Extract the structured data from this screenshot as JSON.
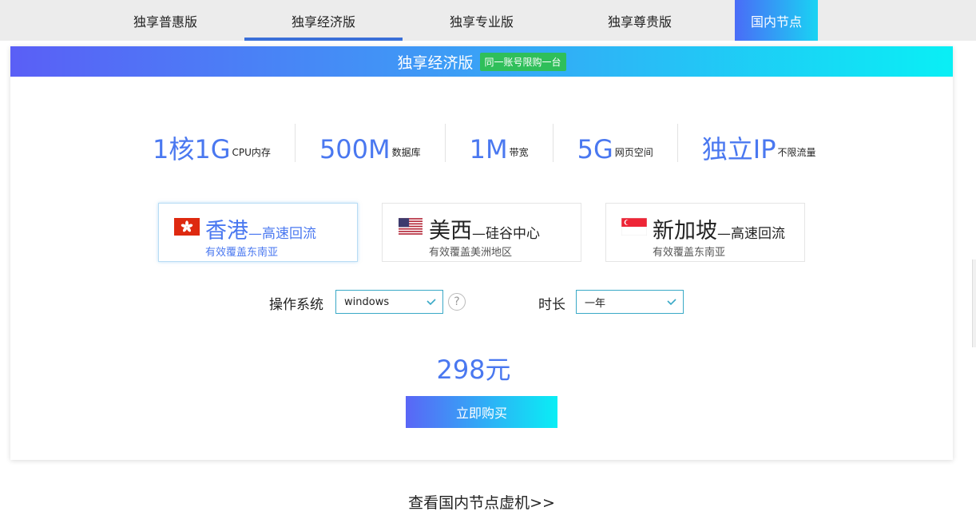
{
  "tabs": [
    {
      "label": "独享普惠版"
    },
    {
      "label": "独享经济版"
    },
    {
      "label": "独享专业版"
    },
    {
      "label": "独享尊贵版"
    },
    {
      "label": "国内节点"
    }
  ],
  "active_tab": "独享经济版",
  "card": {
    "title": "独享经济版",
    "limit_badge": "同一账号限购一台"
  },
  "specs": [
    {
      "value": "1核1G",
      "unit": "CPU内存"
    },
    {
      "value": "500M",
      "unit": "数据库"
    },
    {
      "value": "1M",
      "unit": "带宽"
    },
    {
      "value": "5G",
      "unit": "网页空间"
    },
    {
      "value": "独立IP",
      "unit": "不限流量"
    }
  ],
  "regions": [
    {
      "name": "香港",
      "sub": "—高速回流",
      "desc": "有效覆盖东南亚",
      "flag": "hong-kong-flag-icon",
      "selected": true
    },
    {
      "name": "美西",
      "sub": "—硅谷中心",
      "desc": "有效覆盖美洲地区",
      "flag": "usa-flag-icon",
      "selected": false
    },
    {
      "name": "新加坡",
      "sub": "—高速回流",
      "desc": "有效覆盖东南亚",
      "flag": "singapore-flag-icon",
      "selected": false
    }
  ],
  "options": {
    "os_label": "操作系统",
    "os_value": "windows",
    "help_symbol": "?",
    "duration_label": "时长",
    "duration_value": "一年"
  },
  "price": "298元",
  "buy_button": "立即购买",
  "bottom_link": "查看国内节点虚机>>",
  "colors": {
    "accent_blue": "#4a78f0",
    "gradient_start": "#5a5ff6",
    "gradient_end": "#09eff5",
    "badge_green": "#2fbf5a"
  }
}
